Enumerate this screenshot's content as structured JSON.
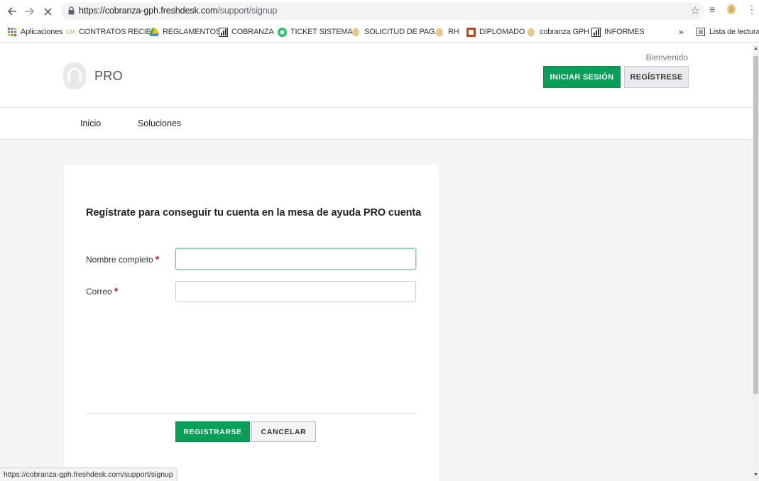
{
  "browser": {
    "url_host": "https://cobranza-gph.freshdesk.com",
    "url_path": "/support/signup",
    "bookmarks": [
      {
        "label": "Aplicaciones",
        "icon": "apps-grid-icon"
      },
      {
        "label": "CONTRATOS RECIE...",
        "icon": "cm-icon"
      },
      {
        "label": "REGLAMENTOS",
        "icon": "drive-icon"
      },
      {
        "label": "COBRANZA",
        "icon": "chart-icon"
      },
      {
        "label": "TICKET SISTEMAS",
        "icon": "freshdesk-icon"
      },
      {
        "label": "SOLICITUD DE PAG...",
        "icon": "flower-icon"
      },
      {
        "label": "RH",
        "icon": "flower-icon"
      },
      {
        "label": "DIPLOMADO",
        "icon": "office-icon"
      },
      {
        "label": "cobranza GPH",
        "icon": "flower-icon"
      },
      {
        "label": "INFORMES",
        "icon": "chart-icon"
      }
    ],
    "more_bookmarks": "»",
    "reading_list": "Lista de lectura"
  },
  "header": {
    "brand": "PRO",
    "welcome": "Bienvenido",
    "login_label": "INICIAR SESIÓN",
    "register_label": "REGÍSTRESE"
  },
  "subnav": {
    "items": [
      "Inicio",
      "Soluciones"
    ]
  },
  "form": {
    "title": "Regístrate para conseguir tu cuenta en la mesa de ayuda PRO cuenta",
    "name_label": "Nombre completo",
    "email_label": "Correo",
    "required_mark": "*",
    "name_value": "",
    "email_value": "",
    "submit_label": "REGISTRARSE",
    "cancel_label": "CANCELAR"
  },
  "status": {
    "link": "https://cobranza-gph.freshdesk.com/support/signup"
  },
  "colors": {
    "accent": "#0a9f58",
    "required": "#c8102e"
  }
}
